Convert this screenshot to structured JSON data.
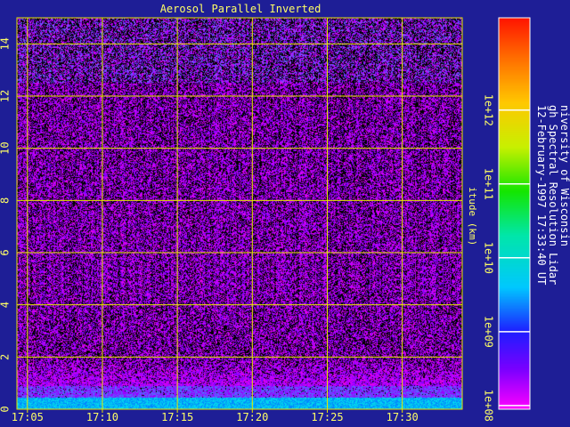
{
  "chart_data": {
    "type": "heatmap",
    "title": "Aerosol Parallel Inverted",
    "ylabel": "itude (km)",
    "xlabel": "",
    "x_ticks": [
      "17:05",
      "17:10",
      "17:15",
      "17:20",
      "17:25",
      "17:30"
    ],
    "x_tick_minutes": [
      5,
      10,
      15,
      20,
      25,
      30
    ],
    "xlim_minutes": [
      4.3,
      34.0
    ],
    "y_ticks": [
      0,
      2,
      4,
      6,
      8,
      10,
      12,
      14
    ],
    "ylim": [
      0,
      15
    ],
    "grid": true,
    "colorbar": {
      "ticks": [
        "1e+08",
        "1e+09",
        "1e+10",
        "1e+11",
        "1e+12"
      ],
      "exponents": [
        8,
        9,
        10,
        11,
        12
      ],
      "range_exponent": [
        7.95,
        13.25
      ],
      "scale": "log"
    },
    "annotation_lines": [
      "niversity of Wisconsin",
      "gh Spectral Resolution Lidar",
      "12-February-1997 17:33:40 UT"
    ],
    "profile": [
      {
        "alt_km": 0.0,
        "dominant": "cyan",
        "fill_fraction": 0.99
      },
      {
        "alt_km": 0.4,
        "dominant": "blue",
        "fill_fraction": 0.97
      },
      {
        "alt_km": 0.9,
        "dominant": "violet",
        "fill_fraction": 0.9
      },
      {
        "alt_km": 2.0,
        "dominant": "magenta-violet",
        "fill_fraction": 0.55
      },
      {
        "alt_km": 5.0,
        "dominant": "magenta-violet",
        "fill_fraction": 0.6
      },
      {
        "alt_km": 13.0,
        "dominant": "violet-blue",
        "fill_fraction": 0.55
      }
    ]
  },
  "colors": {
    "background": "#1e1e96",
    "grid": "#e6e600",
    "text": "#ffff66",
    "annotation_text": "#ffffff",
    "noise": [
      "#cc00ff",
      "#9900ff",
      "#e600e6",
      "#7a00ff"
    ],
    "near_ground": [
      "#00bbee",
      "#0088ff",
      "#00d8f0"
    ],
    "upper_noise": [
      "#5566ff",
      "#7a5cff"
    ]
  }
}
